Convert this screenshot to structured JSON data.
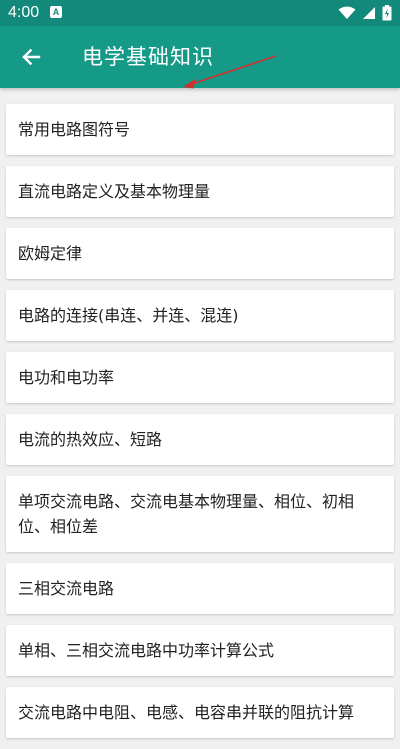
{
  "status_bar": {
    "time": "4:00",
    "notification_icon": "A",
    "icons": [
      "wifi-icon",
      "signal-icon",
      "battery-icon"
    ]
  },
  "appbar": {
    "title": "电学基础知识",
    "back_icon": "arrow-left-icon",
    "color": "#159a88"
  },
  "annotation": {
    "color": "#d32f2f"
  },
  "items": [
    {
      "label": "常用电路图符号"
    },
    {
      "label": "直流电路定义及基本物理量"
    },
    {
      "label": "欧姆定律"
    },
    {
      "label": "电路的连接(串连、并连、混连)"
    },
    {
      "label": "电功和电功率"
    },
    {
      "label": "电流的热效应、短路"
    },
    {
      "label": "单项交流电路、交流电基本物理量、相位、初相位、相位差"
    },
    {
      "label": "三相交流电路"
    },
    {
      "label": "单相、三相交流电路中功率计算公式"
    },
    {
      "label": "交流电路中电阻、电感、电容串并联的阻抗计算"
    }
  ]
}
